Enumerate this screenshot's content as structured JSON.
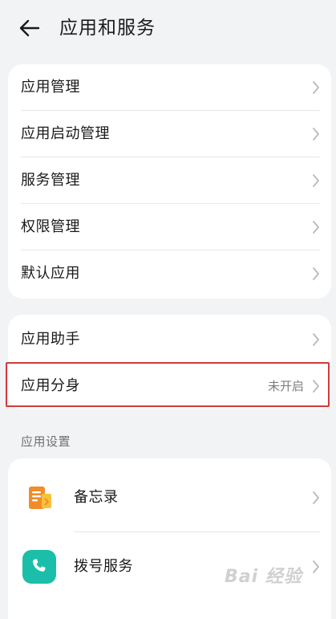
{
  "header": {
    "title": "应用和服务",
    "back_icon": "arrow-left-icon"
  },
  "group1": {
    "items": [
      {
        "label": "应用管理"
      },
      {
        "label": "应用启动管理"
      },
      {
        "label": "服务管理"
      },
      {
        "label": "权限管理"
      },
      {
        "label": "默认应用"
      }
    ]
  },
  "group2": {
    "items": [
      {
        "label": "应用助手"
      },
      {
        "label": "应用分身",
        "value": "未开启",
        "highlighted": true
      }
    ]
  },
  "section": {
    "title": "应用设置"
  },
  "apps": {
    "items": [
      {
        "label": "备忘录",
        "icon": "memo-icon"
      },
      {
        "label": "拨号服务",
        "icon": "phone-icon"
      }
    ]
  },
  "watermark": {
    "text": "Bai 经验"
  },
  "colors": {
    "highlight": "#d23a3a",
    "phone_icon": "#1bbfa9",
    "memo_icon": "#f28c28",
    "background": "#f1f3f5"
  }
}
